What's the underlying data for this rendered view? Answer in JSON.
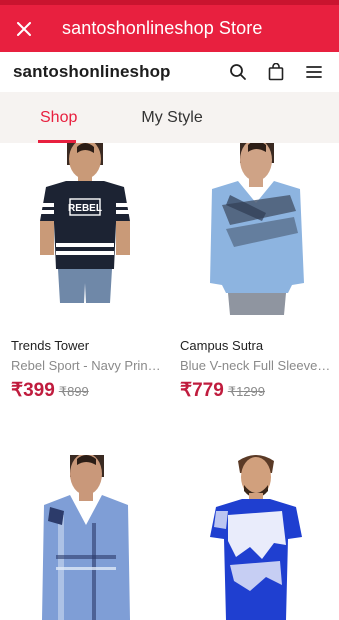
{
  "topbar": {
    "close_icon": "close-icon",
    "title": "santoshonlineshop Store"
  },
  "shopbar": {
    "shop_name": "santoshonlineshop",
    "icons": [
      "search-icon",
      "shopping-bag-icon",
      "menu-icon"
    ]
  },
  "tabs": [
    {
      "label": "Shop",
      "active": true
    },
    {
      "label": "My Style",
      "active": false
    }
  ],
  "products": [
    {
      "brand": "Trends Tower",
      "name": "Rebel Sport - Navy Printed Round Neck T-Shirt",
      "price": "₹399",
      "mrp": "₹899",
      "tee_print": "REBEL"
    },
    {
      "brand": "Campus Sutra",
      "name": "Blue V-neck Full Sleeve Solid T-Shirt",
      "price": "₹779",
      "mrp": "₹1299"
    },
    {
      "brand": "",
      "name": "",
      "price": "",
      "mrp": ""
    },
    {
      "brand": "",
      "name": "",
      "price": "",
      "mrp": ""
    }
  ],
  "colors": {
    "brand_red": "#e8203f",
    "price_red": "#c01c3e",
    "tab_bg": "#f6f3f1"
  }
}
